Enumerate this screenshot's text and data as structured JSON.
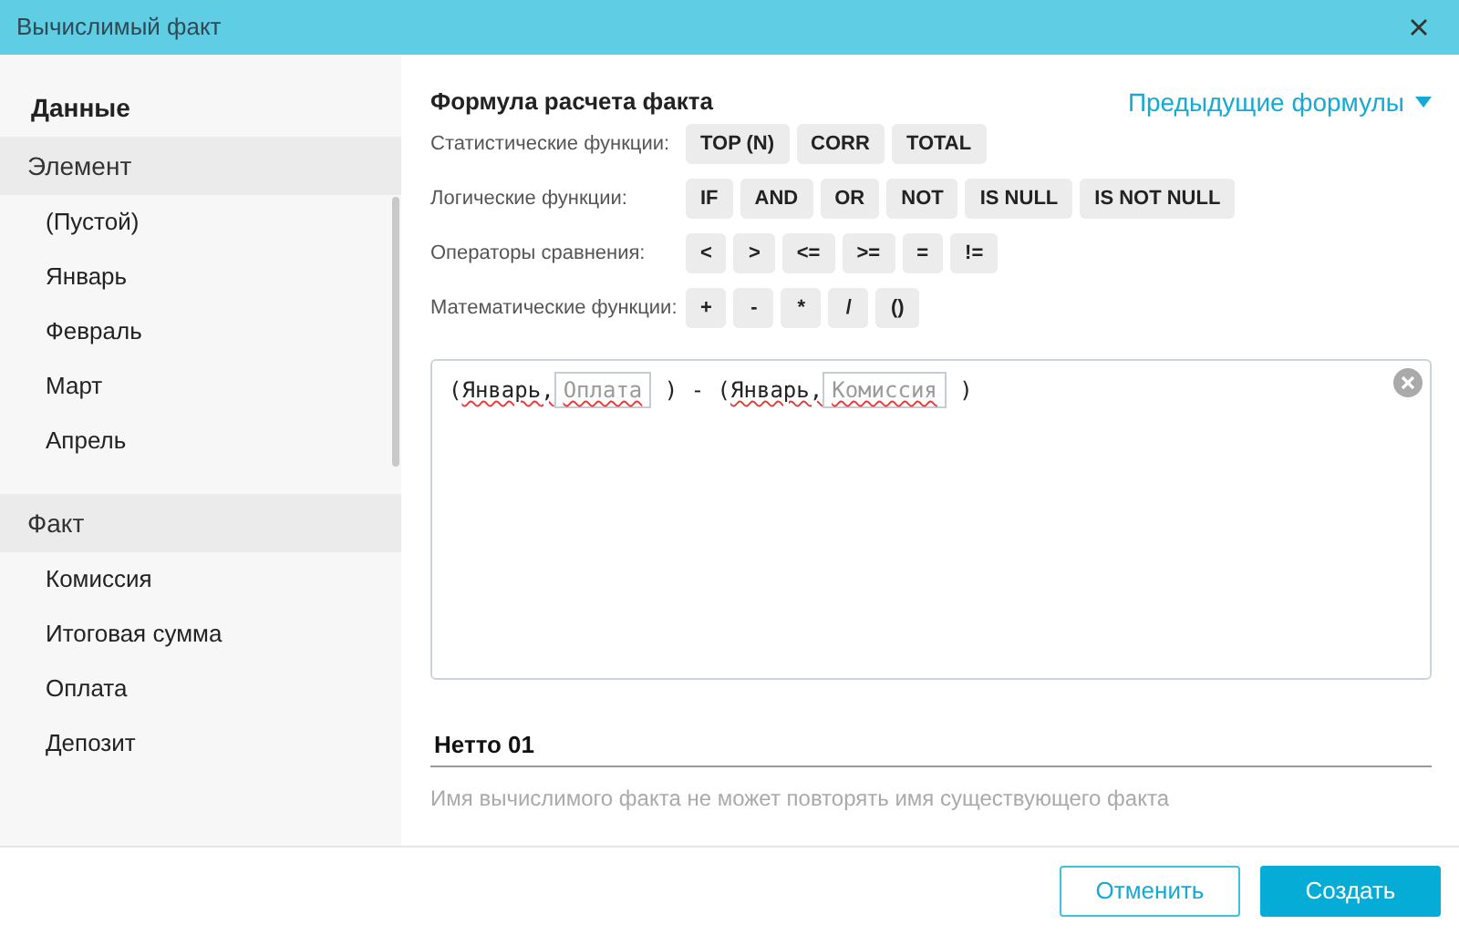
{
  "window": {
    "title": "Вычислимый факт"
  },
  "sidebar": {
    "title": "Данные",
    "sections": [
      {
        "label": "Элемент",
        "items": [
          "(Пустой)",
          "Январь",
          "Февраль",
          "Март",
          "Апрель"
        ],
        "scrollbar": true
      },
      {
        "label": "Факт",
        "items": [
          "Комиссия",
          "Итоговая сумма",
          "Оплата",
          "Депозит"
        ],
        "scrollbar": false
      }
    ]
  },
  "formula": {
    "title": "Формула расчета факта",
    "history_link": "Предыдущие формулы",
    "groups": [
      {
        "label": "Статистические функции:",
        "buttons": [
          "TOP (N)",
          "CORR",
          "TOTAL"
        ]
      },
      {
        "label": "Логические функции:",
        "buttons": [
          "IF",
          "AND",
          "OR",
          "NOT",
          "IS NULL",
          "IS NOT NULL"
        ]
      },
      {
        "label": "Операторы сравнения:",
        "buttons": [
          "<",
          ">",
          "<=",
          ">=",
          "=",
          "!="
        ]
      },
      {
        "label": "Математические функции:",
        "buttons": [
          "+",
          "-",
          "*",
          "/",
          "()"
        ]
      }
    ],
    "editor": {
      "tokens": [
        {
          "kind": "text",
          "text": "(",
          "spell_error": false
        },
        {
          "kind": "text",
          "text": "Январь,",
          "spell_error": true
        },
        {
          "kind": "field",
          "text": "Оплата",
          "spell_error": true
        },
        {
          "kind": "text",
          "text": " ) - (",
          "spell_error": false
        },
        {
          "kind": "text",
          "text": "Январь,",
          "spell_error": true
        },
        {
          "kind": "field",
          "text": "Комиссия",
          "spell_error": true
        },
        {
          "kind": "text",
          "text": " )",
          "spell_error": false
        }
      ]
    }
  },
  "name_field": {
    "value": "Нетто 01",
    "hint": "Имя вычислимого факта не может повторять имя существующего факта"
  },
  "buttons": [
    {
      "label": "Отменить",
      "kind": "secondary"
    },
    {
      "label": "Создать",
      "kind": "primary"
    }
  ]
}
